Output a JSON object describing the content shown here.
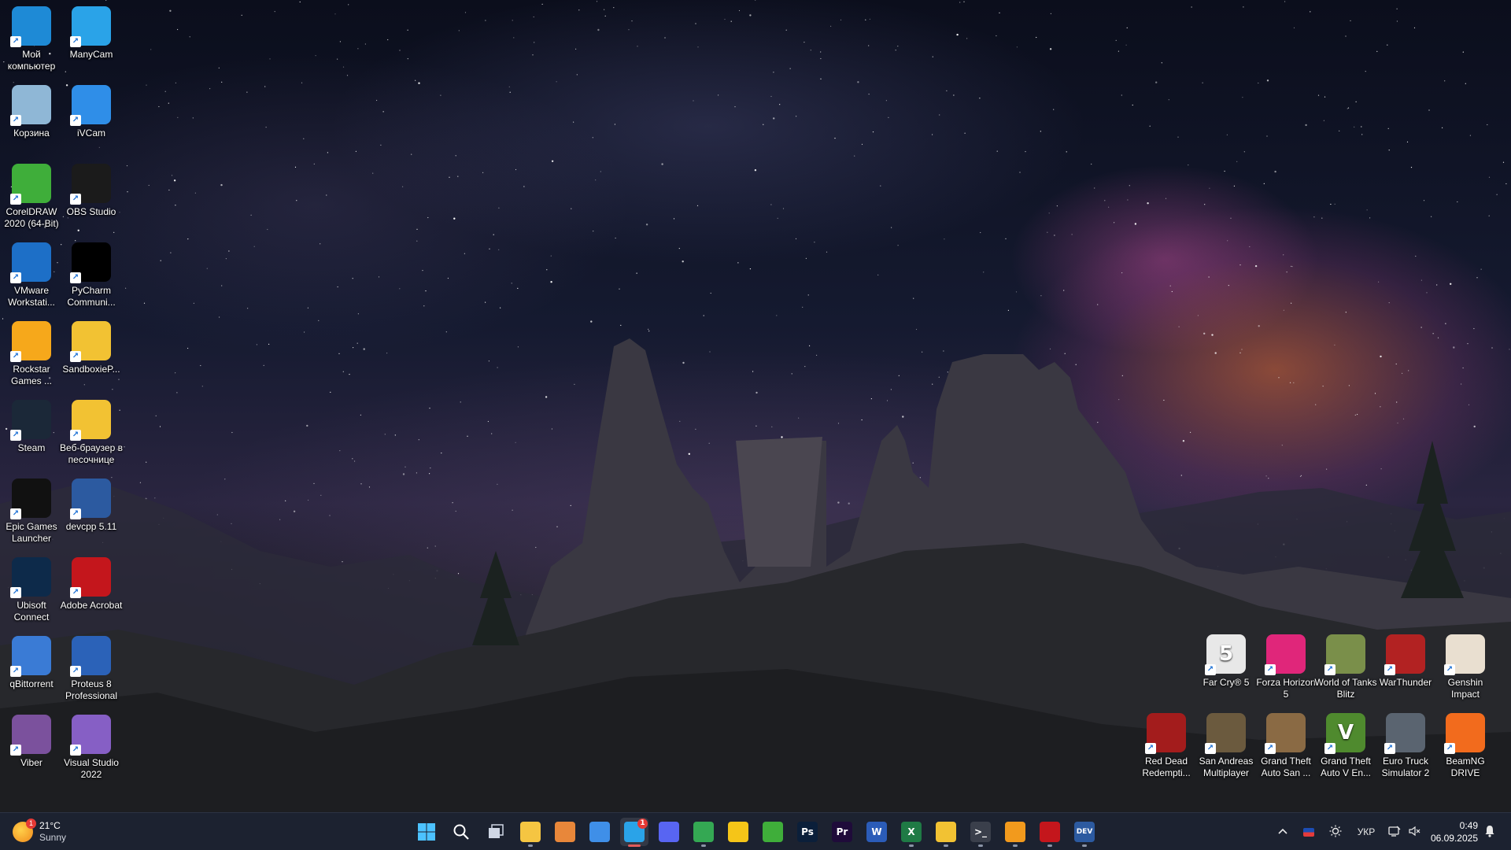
{
  "desktop": {
    "left_icons": [
      {
        "label": "Мой компьютер",
        "icon": "monitor-icon",
        "color": "#1e8ad6"
      },
      {
        "label": "ManyCam",
        "icon": "manycam-icon",
        "color": "#2aa3e8"
      },
      {
        "label": "Корзина",
        "icon": "recycle-bin-icon",
        "color": "#8fb7d6"
      },
      {
        "label": "iVCam",
        "icon": "ivcam-icon",
        "color": "#2f8ee8"
      },
      {
        "label": "CorelDRAW 2020 (64-Bit)",
        "icon": "coreldraw-icon",
        "color": "#3fae3a"
      },
      {
        "label": "OBS Studio",
        "icon": "obs-icon",
        "color": "#1b1b1b"
      },
      {
        "label": "VMware Workstati...",
        "icon": "vmware-icon",
        "color": "#1d6fc7"
      },
      {
        "label": "PyCharm Communi...",
        "icon": "pycharm-icon",
        "color": "#000000"
      },
      {
        "label": "Rockstar Games ...",
        "icon": "rockstar-icon",
        "color": "#f6a81b"
      },
      {
        "label": "SandboxieP...",
        "icon": "sandboxie-icon",
        "color": "#f2c233"
      },
      {
        "label": "Steam",
        "icon": "steam-icon",
        "color": "#1b2838"
      },
      {
        "label": "Веб-браузер в песочнице",
        "icon": "sandbox-browser-icon",
        "color": "#f2c233"
      },
      {
        "label": "Epic Games Launcher",
        "icon": "epic-games-icon",
        "color": "#111111"
      },
      {
        "label": "devcpp 5.11",
        "icon": "devcpp-icon",
        "color": "#2c5aa0"
      },
      {
        "label": "Ubisoft Connect",
        "icon": "ubisoft-icon",
        "color": "#0d2a4a"
      },
      {
        "label": "Adobe Acrobat",
        "icon": "acrobat-icon",
        "color": "#c4161c"
      },
      {
        "label": "qBittorrent",
        "icon": "qbittorrent-icon",
        "color": "#3a7bd5"
      },
      {
        "label": "Proteus 8 Professional",
        "icon": "proteus-icon",
        "color": "#2b62b8"
      },
      {
        "label": "Viber",
        "icon": "viber-icon",
        "color": "#7b519d"
      },
      {
        "label": "Visual Studio 2022",
        "icon": "visual-studio-icon",
        "color": "#865fc5"
      }
    ],
    "right_icons_row1": [
      {
        "label": "Far Cry® 5",
        "icon": "far-cry-5-icon",
        "color": "#e8e8e8",
        "glyph": "5"
      },
      {
        "label": "Forza Horizon 5",
        "icon": "forza-horizon-5-icon",
        "color": "#e0267a",
        "glyph": ""
      },
      {
        "label": "World of Tanks Blitz",
        "icon": "wot-blitz-icon",
        "color": "#7a8f4a",
        "glyph": ""
      },
      {
        "label": "WarThunder",
        "icon": "warthunder-icon",
        "color": "#b22222",
        "glyph": ""
      },
      {
        "label": "Genshin Impact",
        "icon": "genshin-icon",
        "color": "#e9dfd0",
        "glyph": ""
      }
    ],
    "right_icons_row2": [
      {
        "label": "Red Dead Redempti...",
        "icon": "red-dead-icon",
        "color": "#a31c1c",
        "glyph": ""
      },
      {
        "label": "San Andreas Multiplayer",
        "icon": "samp-icon",
        "color": "#6b5a3e",
        "glyph": ""
      },
      {
        "label": "Grand Theft Auto San ...",
        "icon": "gta-sa-icon",
        "color": "#8a6a44",
        "glyph": ""
      },
      {
        "label": "Grand Theft Auto V En...",
        "icon": "gta-v-icon",
        "color": "#4f8a2e",
        "glyph": "V"
      },
      {
        "label": "Euro Truck Simulator 2",
        "icon": "ets2-icon",
        "color": "#5a6470",
        "glyph": ""
      },
      {
        "label": "BeamNG DRIVE",
        "icon": "beamng-icon",
        "color": "#f26b1d",
        "glyph": ""
      }
    ]
  },
  "taskbar": {
    "weather": {
      "temp": "21°C",
      "condition": "Sunny",
      "badge": "1"
    },
    "apps": [
      {
        "name": "start-button",
        "icon": "windows-icon",
        "color": "#4cc2ff",
        "glyph": "",
        "running": false,
        "active": false,
        "badge": ""
      },
      {
        "name": "search-button",
        "icon": "search-icon",
        "color": "#ffffff",
        "glyph": "",
        "running": false,
        "active": false,
        "badge": ""
      },
      {
        "name": "task-view-button",
        "icon": "task-view-icon",
        "color": "#cfd6e4",
        "glyph": "",
        "running": false,
        "active": false,
        "badge": ""
      },
      {
        "name": "file-explorer-button",
        "icon": "folder-icon",
        "color": "#f5c542",
        "glyph": "",
        "running": true,
        "active": false,
        "badge": ""
      },
      {
        "name": "paint-app-button",
        "icon": "paint-icon",
        "color": "#e8873a",
        "glyph": "",
        "running": false,
        "active": false,
        "badge": ""
      },
      {
        "name": "photos-app-button",
        "icon": "photos-icon",
        "color": "#3f8fe8",
        "glyph": "",
        "running": false,
        "active": false,
        "badge": ""
      },
      {
        "name": "telegram-button",
        "icon": "telegram-icon",
        "color": "#2aa3e8",
        "glyph": "",
        "running": true,
        "active": true,
        "badge": "1"
      },
      {
        "name": "discord-button",
        "icon": "discord-icon",
        "color": "#5865f2",
        "glyph": "",
        "running": false,
        "active": false,
        "badge": ""
      },
      {
        "name": "chrome-button",
        "icon": "chrome-icon",
        "color": "#34a853",
        "glyph": "",
        "running": true,
        "active": false,
        "badge": ""
      },
      {
        "name": "norton-button",
        "icon": "shield-icon",
        "color": "#f5c518",
        "glyph": "",
        "running": false,
        "active": false,
        "badge": ""
      },
      {
        "name": "coreldraw-taskbar-button",
        "icon": "coreldraw-icon",
        "color": "#3fae3a",
        "glyph": "",
        "running": false,
        "active": false,
        "badge": ""
      },
      {
        "name": "photoshop-button",
        "icon": "photoshop-icon",
        "color": "#0b1f3a",
        "glyph": "Ps",
        "running": false,
        "active": false,
        "badge": ""
      },
      {
        "name": "premiere-button",
        "icon": "premiere-icon",
        "color": "#1f0b3a",
        "glyph": "Pr",
        "running": false,
        "active": false,
        "badge": ""
      },
      {
        "name": "word-button",
        "icon": "word-icon",
        "color": "#2b5cb8",
        "glyph": "W",
        "running": false,
        "active": false,
        "badge": ""
      },
      {
        "name": "excel-button",
        "icon": "excel-icon",
        "color": "#1f7a45",
        "glyph": "X",
        "running": true,
        "active": false,
        "badge": ""
      },
      {
        "name": "sandboxie-taskbar-button",
        "icon": "sandboxie-icon",
        "color": "#f2c233",
        "glyph": "",
        "running": true,
        "active": false,
        "badge": ""
      },
      {
        "name": "terminal-button",
        "icon": "terminal-icon",
        "color": "#3a3f4b",
        "glyph": ">_",
        "running": true,
        "active": false,
        "badge": ""
      },
      {
        "name": "vmware-taskbar-button",
        "icon": "vmware-icon",
        "color": "#f29a1d",
        "glyph": "",
        "running": true,
        "active": false,
        "badge": ""
      },
      {
        "name": "acrobat-taskbar-button",
        "icon": "acrobat-icon",
        "color": "#c4161c",
        "glyph": "",
        "running": true,
        "active": false,
        "badge": ""
      },
      {
        "name": "devcpp-taskbar-button",
        "icon": "devcpp-icon",
        "color": "#2c5aa0",
        "glyph": "DEV",
        "running": true,
        "active": false,
        "badge": ""
      }
    ],
    "tray": {
      "language": "УКР",
      "time": "0:49",
      "date": "06.09.2025"
    }
  }
}
